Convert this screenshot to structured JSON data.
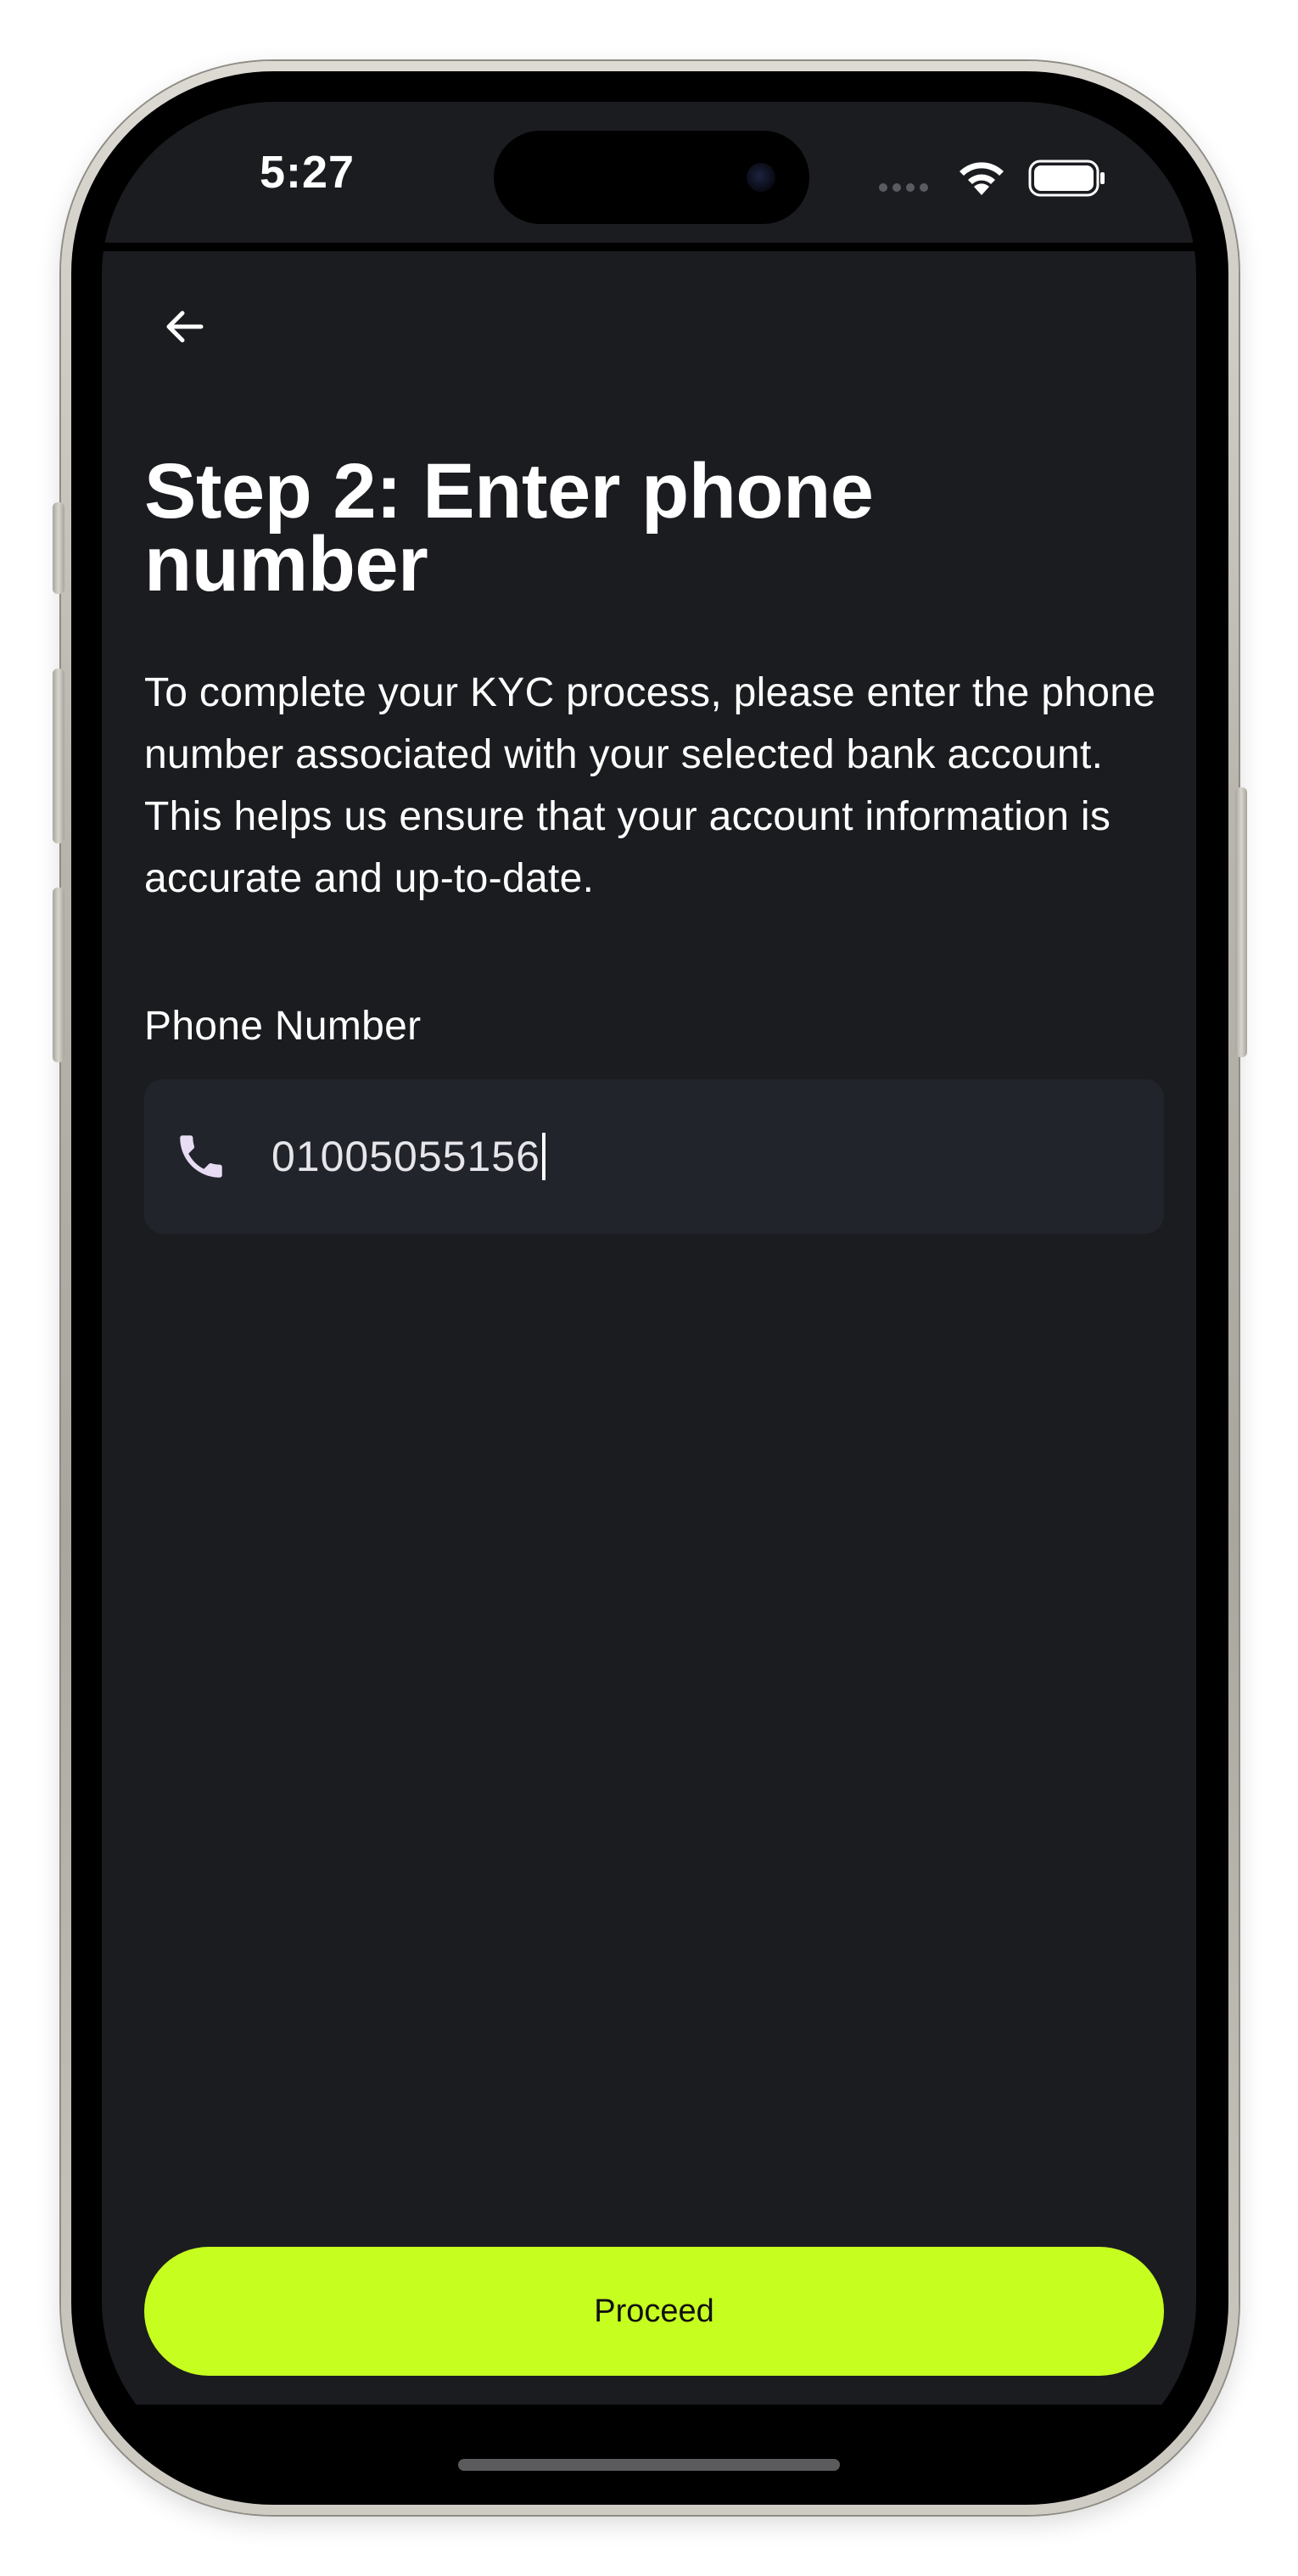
{
  "status_bar": {
    "time": "5:27"
  },
  "header": {
    "back_icon": "arrow-left-icon"
  },
  "title": "Step 2: Enter phone number",
  "description": "To complete your KYC process, please enter the phone number associated with your selected bank account. This helps us ensure that your account information is accurate and up-to-date.",
  "phone_field": {
    "label": "Phone Number",
    "icon": "phone-icon",
    "value": "01005055156"
  },
  "proceed_button": {
    "label": "Proceed"
  },
  "colors": {
    "background": "#1b1c20",
    "field_background": "#22242c",
    "accent": "#c6ff1f",
    "icon_tint": "#e8dcf4",
    "text": "#ffffff"
  }
}
